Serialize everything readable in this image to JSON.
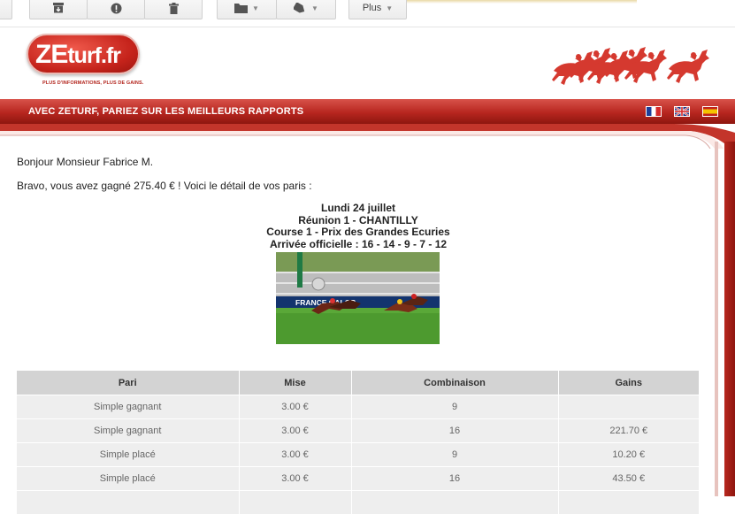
{
  "toolbar": {
    "buttons": [
      {
        "icon": "archive-icon"
      },
      {
        "icon": "report-spam-icon"
      },
      {
        "icon": "delete-icon"
      },
      {
        "icon": "folder-icon"
      },
      {
        "icon": "label-icon"
      }
    ],
    "more_label": "Plus"
  },
  "email": {
    "logo": {
      "brand": "ZEturf.fr",
      "brand_main": "ZE",
      "brand_rest": "turf.fr",
      "tagline": "PLUS D'INFORMATIONS, PLUS DE GAINS."
    },
    "banner_text": "AVEC ZETURF, PARIEZ SUR LES MEILLEURS RAPPORTS",
    "languages": [
      "fr-flag-icon",
      "uk-flag-icon",
      "es-flag-icon"
    ],
    "greeting": "Bonjour Monsieur Fabrice M.",
    "message": "Bravo, vous avez gagné 275.40 € ! Voici le détail de vos paris :",
    "race": {
      "date": "Lundi 24 juillet",
      "meeting": "Réunion 1 - CHANTILLY",
      "course": "Course 1 - Prix des Grandes Ecuries",
      "arrival": "Arrivée officielle : 16 - 14 - 9 - 7 - 12"
    },
    "photo_banner_text": "FRANCE GALOP",
    "table": {
      "headers": [
        "Pari",
        "Mise",
        "Combinaison",
        "Gains"
      ],
      "rows": [
        [
          "Simple gagnant",
          "3.00 €",
          "9",
          ""
        ],
        [
          "Simple gagnant",
          "3.00 €",
          "16",
          "221.70 €"
        ],
        [
          "Simple placé",
          "3.00 €",
          "9",
          "10.20 €"
        ],
        [
          "Simple placé",
          "3.00 €",
          "16",
          "43.50 €"
        ],
        [
          "",
          "",
          "",
          ""
        ]
      ]
    }
  },
  "colors": {
    "brand_red": "#c3231b",
    "table_header": "#d3d3d3",
    "table_row": "#eeeeee"
  }
}
